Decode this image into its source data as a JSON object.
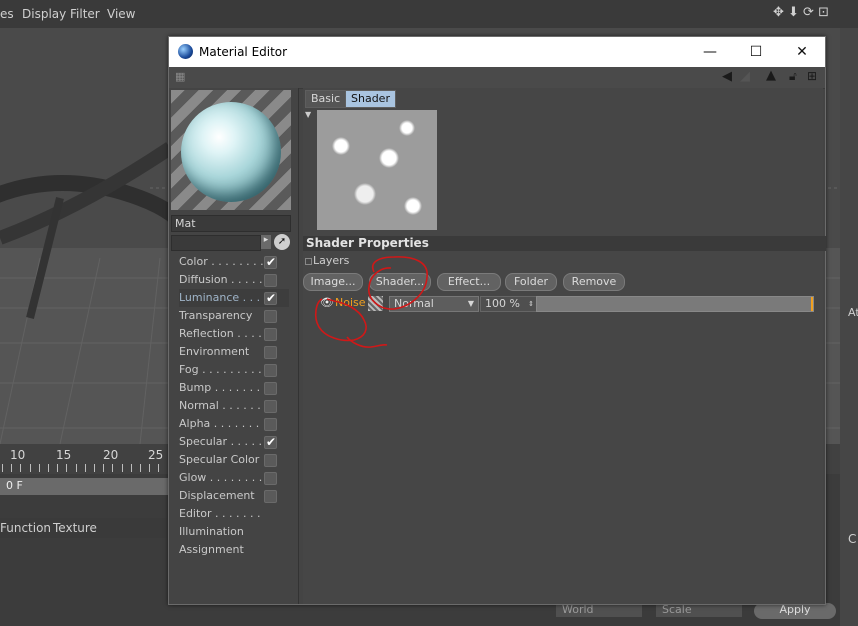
{
  "bg_app": {
    "menu": [
      "es",
      "Display",
      "Filter",
      "View"
    ],
    "timeline_numbers": [
      "10",
      "15",
      "20",
      "25"
    ],
    "frame_value": "0 F",
    "bottom_tabs": [
      "Function",
      "Texture"
    ],
    "bottom_controls": {
      "coord": "World",
      "scale": "Scale",
      "apply": "Apply"
    },
    "right_labels": [
      "At",
      "C"
    ]
  },
  "window": {
    "title": "Material Editor",
    "minimize": "—",
    "maximize": "☐",
    "close": "✕"
  },
  "material": {
    "name": "Mat",
    "channels": [
      {
        "label": "Color . . . . . . . .",
        "checked": true
      },
      {
        "label": "Diffusion . . . . . .",
        "checked": false
      },
      {
        "label": "Luminance . . . .",
        "checked": true,
        "selected": true
      },
      {
        "label": "Transparency",
        "checked": false
      },
      {
        "label": "Reflection . . . . .",
        "checked": false
      },
      {
        "label": "Environment",
        "checked": false
      },
      {
        "label": "Fog . . . . . . . . .",
        "checked": false
      },
      {
        "label": "Bump . . . . . . .",
        "checked": false
      },
      {
        "label": "Normal . . . . . .",
        "checked": false
      },
      {
        "label": "Alpha . . . . . . .",
        "checked": false
      },
      {
        "label": "Specular . . . . .",
        "checked": true
      },
      {
        "label": "Specular Color",
        "checked": false
      },
      {
        "label": "Glow . . . . . . . .",
        "checked": false
      },
      {
        "label": "Displacement",
        "checked": false
      },
      {
        "label": "Editor . . . . . . .",
        "checked": null
      },
      {
        "label": "Illumination",
        "checked": null
      },
      {
        "label": "Assignment",
        "checked": null
      }
    ]
  },
  "shader": {
    "tabs": [
      "Basic",
      "Shader"
    ],
    "active_tab": "Shader",
    "properties_title": "Shader Properties",
    "layers_label": "Layers",
    "buttons": [
      "Image...",
      "Shader...",
      "Effect...",
      "Folder",
      "Remove"
    ],
    "layer": {
      "name": "Noise",
      "blend": "Normal",
      "opacity": "100 %"
    }
  },
  "colors": {
    "annotation": "#d01818",
    "layer_name": "#f0a020",
    "selected_tab": "#a9c4e0"
  }
}
